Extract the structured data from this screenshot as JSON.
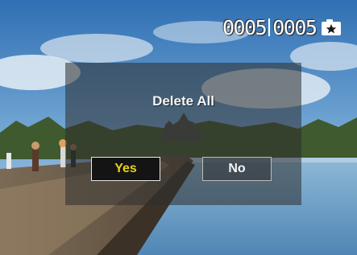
{
  "status": {
    "counter_current": "0005",
    "counter_total": "0005",
    "protect_icon": "protected-star-icon"
  },
  "dialog": {
    "title": "Delete All",
    "yes_label": "Yes",
    "no_label": "No",
    "selected": "Yes"
  },
  "colors": {
    "selected_text": "#e6d21a",
    "selected_bg": "#141414",
    "overlay": "rgba(45,45,45,0.55)"
  }
}
